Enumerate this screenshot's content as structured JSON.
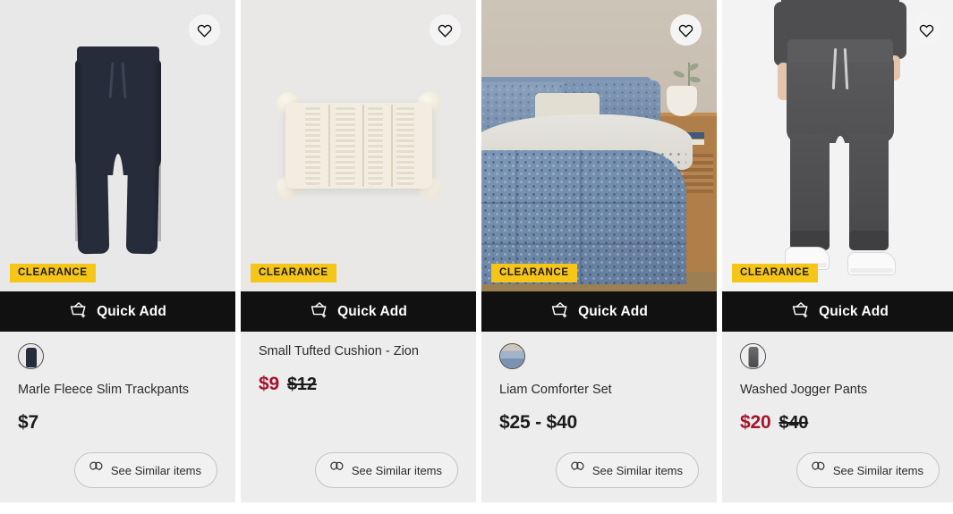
{
  "page": {
    "background": "#ffffff",
    "card_background": "#ededed",
    "badge_color": "#f5c518",
    "sale_price_color": "#a5122a",
    "quick_add_background": "#111111"
  },
  "labels": {
    "quick_add": "Quick Add",
    "see_similar": "See Similar items",
    "clearance": "CLEARANCE",
    "wishlist_icon": "heart-icon",
    "quick_add_icon": "basket-plus-icon",
    "similar_icon": "similar-items-icon"
  },
  "products": [
    {
      "id": "marle-fleece-slim-trackpants",
      "title": "Marle Fleece Slim Trackpants",
      "badge": "CLEARANCE",
      "quick_add": "Quick Add",
      "similar": "See Similar items",
      "price_now": "$7",
      "price_was": "",
      "on_sale": false,
      "has_swatch": true,
      "swatch_name": "colour-swatch-navy"
    },
    {
      "id": "small-tufted-cushion-zion",
      "title": "Small Tufted Cushion - Zion",
      "badge": "CLEARANCE",
      "quick_add": "Quick Add",
      "similar": "See Similar items",
      "price_now": "$9",
      "price_was": "$12",
      "on_sale": true,
      "has_swatch": false,
      "swatch_name": ""
    },
    {
      "id": "liam-comforter-set",
      "title": "Liam Comforter Set",
      "badge": "CLEARANCE",
      "quick_add": "Quick Add",
      "similar": "See Similar items",
      "price_now": "$25 - $40",
      "price_was": "",
      "on_sale": false,
      "has_swatch": true,
      "swatch_name": "colour-swatch-blue"
    },
    {
      "id": "washed-jogger-pants",
      "title": "Washed Jogger Pants",
      "badge": "CLEARANCE",
      "quick_add": "Quick Add",
      "similar": "See Similar items",
      "price_now": "$20",
      "price_was": "$40",
      "on_sale": true,
      "has_swatch": true,
      "swatch_name": "colour-swatch-grey"
    }
  ]
}
